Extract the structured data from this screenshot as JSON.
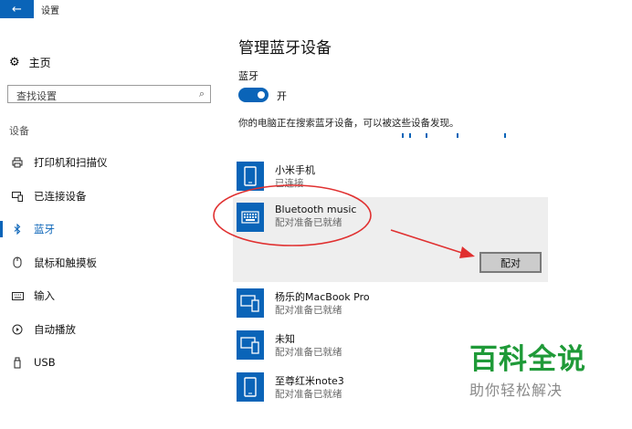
{
  "window": {
    "title": "设置",
    "back_icon": "arrow-left-icon"
  },
  "sidebar": {
    "home_label": "主页",
    "search_placeholder": "查找设置",
    "group_label": "设备",
    "items": [
      {
        "label": "打印机和扫描仪",
        "icon": "printer-icon",
        "active": false
      },
      {
        "label": "已连接设备",
        "icon": "connected-devices-icon",
        "active": false
      },
      {
        "label": "蓝牙",
        "icon": "bluetooth-icon",
        "active": true
      },
      {
        "label": "鼠标和触摸板",
        "icon": "mouse-icon",
        "active": false
      },
      {
        "label": "输入",
        "icon": "keyboard-icon",
        "active": false
      },
      {
        "label": "自动播放",
        "icon": "autoplay-icon",
        "active": false
      },
      {
        "label": "USB",
        "icon": "usb-icon",
        "active": false
      }
    ]
  },
  "main": {
    "title": "管理蓝牙设备",
    "bluetooth_label": "蓝牙",
    "toggle_state": "开",
    "discover_text": "你的电脑正在搜索蓝牙设备，可以被这些设备发现。",
    "devices": [
      {
        "name": "小米手机",
        "status": "已连接",
        "icon": "phone-icon"
      },
      {
        "name": "Bluetooth music",
        "status": "配对准备已就绪",
        "icon": "keyboard-icon",
        "selected": true,
        "action": "配对"
      },
      {
        "name": "杨乐的MacBook Pro",
        "status": "配对准备已就绪",
        "icon": "computer-phone-icon"
      },
      {
        "name": "未知",
        "status": "配对准备已就绪",
        "icon": "computer-phone-icon"
      },
      {
        "name": "至尊红米note3",
        "status": "配对准备已就绪",
        "icon": "phone-icon"
      }
    ]
  },
  "colors": {
    "accent": "#0a64b8",
    "annotation": "#e03030",
    "watermark": "#1f9a38"
  },
  "watermark": {
    "title": "百科全说",
    "subtitle": "助你轻松解决"
  }
}
